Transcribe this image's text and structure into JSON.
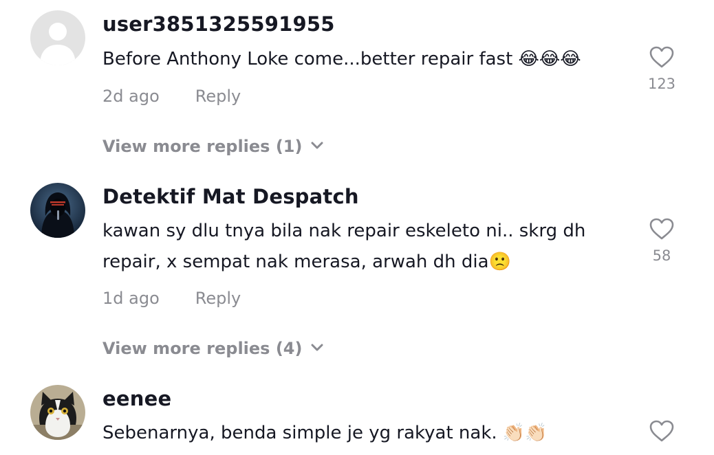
{
  "comments": [
    {
      "username": "user3851325591955",
      "text_lines": [
        "Before Anthony Loke come...better repair fast 😂😂😂"
      ],
      "time": "2d ago",
      "reply_label": "Reply",
      "likes": "123",
      "more_replies": "View more replies (1)",
      "avatar": "default-avatar"
    },
    {
      "username": "Detektif Mat Despatch",
      "text_lines": [
        "kawan sy dlu tnya bila nak repair eskeleto ni.. skrg dh",
        "repair, x sempat nak merasa, arwah dh dia🙁"
      ],
      "time": "1d ago",
      "reply_label": "Reply",
      "likes": "58",
      "more_replies": "View more replies (4)",
      "avatar": "hooded-figure-avatar"
    },
    {
      "username": "eenee",
      "text_lines": [
        "Sebenarnya, benda simple je yg rakyat nak. 👏🏻👏🏻"
      ],
      "avatar": "cat-avatar"
    }
  ],
  "colors": {
    "primary_text": "#161823",
    "secondary_text": "#8a8b91",
    "icon_stroke": "#8a8b91",
    "default_avatar_bg": "#e3e3e3"
  },
  "icons": [
    "heart-icon",
    "chevron-down-icon"
  ]
}
